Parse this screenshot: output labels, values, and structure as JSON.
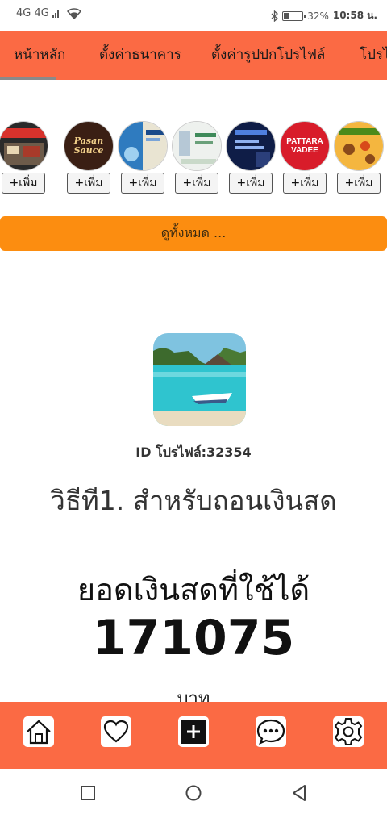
{
  "status_bar": {
    "network": "4G 4G",
    "battery": "32%",
    "battery_level": 0.32,
    "time": "10:58 น."
  },
  "tabs": [
    {
      "label": "หน้าหลัก",
      "active": true
    },
    {
      "label": "ตั้งค่าธนาคาร",
      "active": false
    },
    {
      "label": "ตั้งค่ารูปปกโปรไฟล์",
      "active": false
    },
    {
      "label": "โปรไฟ",
      "active": false
    }
  ],
  "stories": {
    "add_label": "+เพิ่ม",
    "items": [
      {
        "name": "shop-front",
        "caption": "",
        "colors": [
          "#d8322c",
          "#2a2a2a"
        ]
      },
      {
        "name": "pasan-sauce",
        "caption": "Pasan Sauce",
        "colors": [
          "#3a1f14",
          "#f1b52c"
        ]
      },
      {
        "name": "travel-poster",
        "caption": "",
        "colors": [
          "#2f7bbf",
          "#e9e4d2"
        ]
      },
      {
        "name": "green-ad",
        "caption": "",
        "colors": [
          "#eef1ee",
          "#3f8a5a"
        ]
      },
      {
        "name": "business-ad",
        "caption": "",
        "colors": [
          "#0f1d47",
          "#4e7fe0"
        ]
      },
      {
        "name": "pattara-vadee",
        "caption": "PATTARA VADEE",
        "colors": [
          "#d81c2a",
          "#f4f4f4"
        ]
      },
      {
        "name": "food-promo",
        "caption": "",
        "colors": [
          "#f4b63f",
          "#4b8a1a"
        ]
      }
    ]
  },
  "view_all_label": "ดูทั้งหมด ...",
  "profile": {
    "id_label": "ID โปรไฟล์:32354",
    "method_title": "วิธีที1. สำหรับถอนเงินสด",
    "balance_label": "ยอดเงินสดที่ใช้ได้",
    "balance_value": "171075",
    "currency": "บาท"
  },
  "bottom_nav": [
    {
      "name": "home-icon"
    },
    {
      "name": "heart-icon"
    },
    {
      "name": "add-post-icon"
    },
    {
      "name": "chat-icon"
    },
    {
      "name": "settings-icon"
    }
  ],
  "colors": {
    "accent": "#fb6a44",
    "button_orange": "#fc8d10"
  }
}
